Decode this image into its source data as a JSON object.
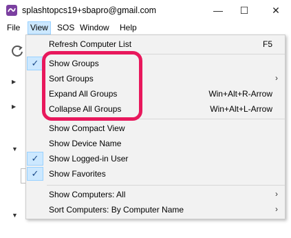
{
  "window": {
    "title": "splashtopcs19+sbapro@gmail.com",
    "minimize_glyph": "—",
    "maximize_glyph": "☐",
    "close_glyph": "✕"
  },
  "menubar": {
    "file": "File",
    "view": "View",
    "sos": "SOS",
    "window": "Window",
    "help": "Help"
  },
  "view_menu": {
    "refresh": {
      "label": "Refresh Computer List",
      "shortcut": "F5"
    },
    "show_groups": {
      "label": "Show Groups",
      "checked": true
    },
    "sort_groups": {
      "label": "Sort Groups",
      "submenu": "›"
    },
    "expand_all": {
      "label": "Expand All Groups",
      "shortcut": "Win+Alt+R-Arrow"
    },
    "collapse_all": {
      "label": "Collapse All Groups",
      "shortcut": "Win+Alt+L-Arrow"
    },
    "compact_view": {
      "label": "Show Compact View"
    },
    "device_name": {
      "label": "Show Device Name"
    },
    "logged_in_user": {
      "label": "Show Logged-in User",
      "checked": true
    },
    "favorites": {
      "label": "Show Favorites",
      "checked": true
    },
    "show_computers": {
      "label": "Show Computers: All",
      "submenu": "›"
    },
    "sort_computers": {
      "label": "Sort Computers: By Computer Name",
      "submenu": "›"
    },
    "check_glyph": "✓"
  },
  "colors": {
    "highlight": "#e8185c",
    "menu_selected": "#cce8ff",
    "app_icon": "#7b3fa0"
  },
  "icons": {
    "app": "splashtop-app-icon",
    "refresh": "refresh-icon"
  }
}
